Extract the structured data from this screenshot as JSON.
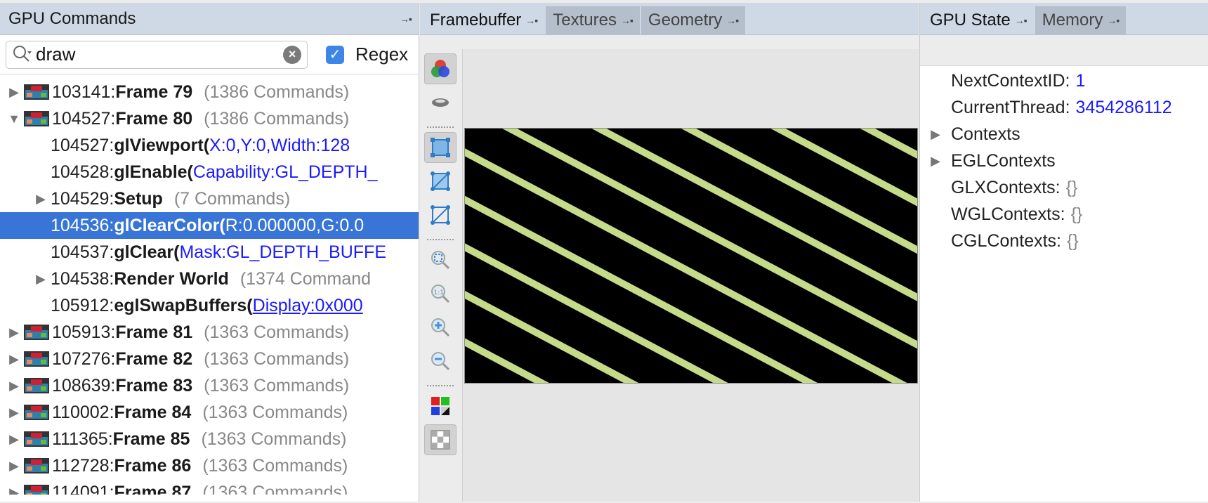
{
  "left_panel": {
    "title": "GPU Commands",
    "search": {
      "value": "draw"
    },
    "regex_label": "Regex",
    "rows": [
      {
        "arrow": "▶",
        "thumb": true,
        "num": "103141:",
        "label": "Frame 79",
        "count": "(1386 Commands)"
      },
      {
        "arrow": "▼",
        "thumb": true,
        "num": "104527:",
        "label": "Frame 80",
        "count": "(1386 Commands)"
      },
      {
        "indent": 1,
        "num": "104527:",
        "label": "glViewport(",
        "params": [
          "X:0,",
          "Y:0,",
          "Width:128"
        ]
      },
      {
        "indent": 1,
        "num": "104528:",
        "label": "glEnable(",
        "params": [
          "Capability:GL_DEPTH_"
        ]
      },
      {
        "indent": 1,
        "arrow": "▶",
        "num": "104529:",
        "label": "Setup",
        "count": "(7 Commands)"
      },
      {
        "indent": 1,
        "selected": true,
        "num": "104536:",
        "label": "glClearColor(",
        "params": [
          "R:0.000000,",
          "G:0.0"
        ]
      },
      {
        "indent": 1,
        "num": "104537:",
        "label": "glClear(",
        "params": [
          "Mask:GL_DEPTH_BUFFE"
        ]
      },
      {
        "indent": 1,
        "arrow": "▶",
        "num": "104538:",
        "label": "Render World",
        "count": "(1374 Command"
      },
      {
        "indent": 1,
        "num": "105912:",
        "label": "eglSwapBuffers(",
        "link": "Display:0x000"
      },
      {
        "arrow": "▶",
        "thumb": true,
        "num": "105913:",
        "label": "Frame 81",
        "count": "(1363 Commands)"
      },
      {
        "arrow": "▶",
        "thumb": true,
        "num": "107276:",
        "label": "Frame 82",
        "count": "(1363 Commands)"
      },
      {
        "arrow": "▶",
        "thumb": true,
        "num": "108639:",
        "label": "Frame 83",
        "count": "(1363 Commands)"
      },
      {
        "arrow": "▶",
        "thumb": true,
        "num": "110002:",
        "label": "Frame 84",
        "count": "(1363 Commands)"
      },
      {
        "arrow": "▶",
        "thumb": true,
        "num": "111365:",
        "label": "Frame 85",
        "count": "(1363 Commands)"
      },
      {
        "arrow": "▶",
        "thumb": true,
        "num": "112728:",
        "label": "Frame 86",
        "count": "(1363 Commands)"
      },
      {
        "arrow": "▶",
        "thumb": true,
        "num": "114091:",
        "label": "Frame 87",
        "count": "(1363 Commands)"
      }
    ]
  },
  "middle_panel": {
    "tabs": [
      {
        "label": "Framebuffer",
        "active": true
      },
      {
        "label": "Textures",
        "active": false
      },
      {
        "label": "Geometry",
        "active": false
      }
    ],
    "toolbar": [
      "color-channels-icon",
      "depth-icon",
      "fit-view-icon",
      "flip-icon",
      "flip-alt-icon",
      "zoom-fit-icon",
      "zoom-actual-icon",
      "zoom-in-icon",
      "zoom-out-icon",
      "color-swatch-icon",
      "checkerboard-icon"
    ]
  },
  "right_panel": {
    "tabs": [
      {
        "label": "GPU State",
        "active": true
      },
      {
        "label": "Memory",
        "active": false
      }
    ],
    "state": [
      {
        "key": "NextContextID",
        "value": "1",
        "type": "value"
      },
      {
        "key": "CurrentThread",
        "value": "3454286112",
        "type": "value"
      },
      {
        "key": "Contexts",
        "expandable": true
      },
      {
        "key": "EGLContexts",
        "expandable": true
      },
      {
        "key": "GLXContexts",
        "value": "{}",
        "type": "empty"
      },
      {
        "key": "WGLContexts",
        "value": "{}",
        "type": "empty"
      },
      {
        "key": "CGLContexts",
        "value": "{}",
        "type": "empty"
      }
    ]
  },
  "colors": {
    "selection": "#3875d7",
    "header": "#cfd9e6",
    "param_blue": "#1a1aff",
    "stripe": "#c5db8a"
  }
}
